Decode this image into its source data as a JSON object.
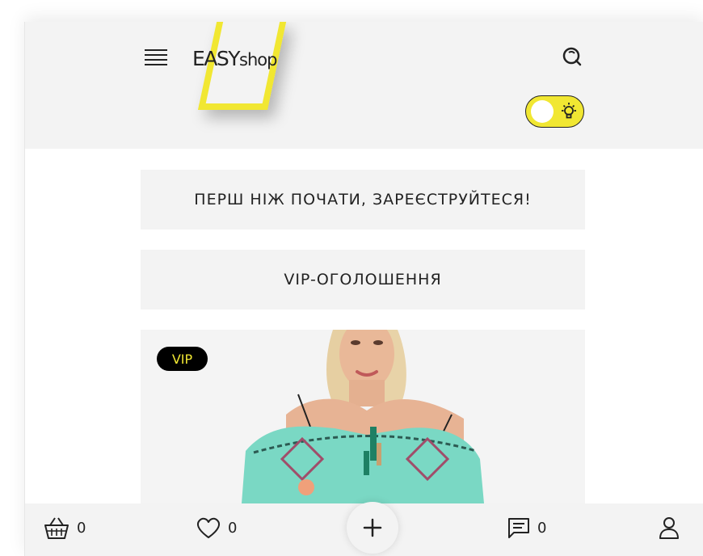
{
  "header": {
    "logo": {
      "brand": "EASY",
      "suffix": "shop"
    },
    "icons": {
      "menu": "hamburger-menu-icon",
      "search": "search-icon",
      "theme": "lightbulb-icon"
    },
    "theme_toggle_on": false
  },
  "banners": {
    "register": "ПЕРШ НІЖ ПОЧАТИ, ЗАРЕЄСТРУЙТЕСЯ!",
    "vip": "VIP-ОГОЛОШЕННЯ"
  },
  "listing": {
    "badge": "VIP"
  },
  "bottom_nav": {
    "cart_count": "0",
    "favorites_count": "0",
    "messages_count": "0",
    "icons": [
      "basket-icon",
      "heart-icon",
      "plus-icon",
      "message-icon",
      "user-icon"
    ]
  },
  "colors": {
    "accent": "#f1e732",
    "panel": "#f3f3f3",
    "text": "#222222"
  }
}
